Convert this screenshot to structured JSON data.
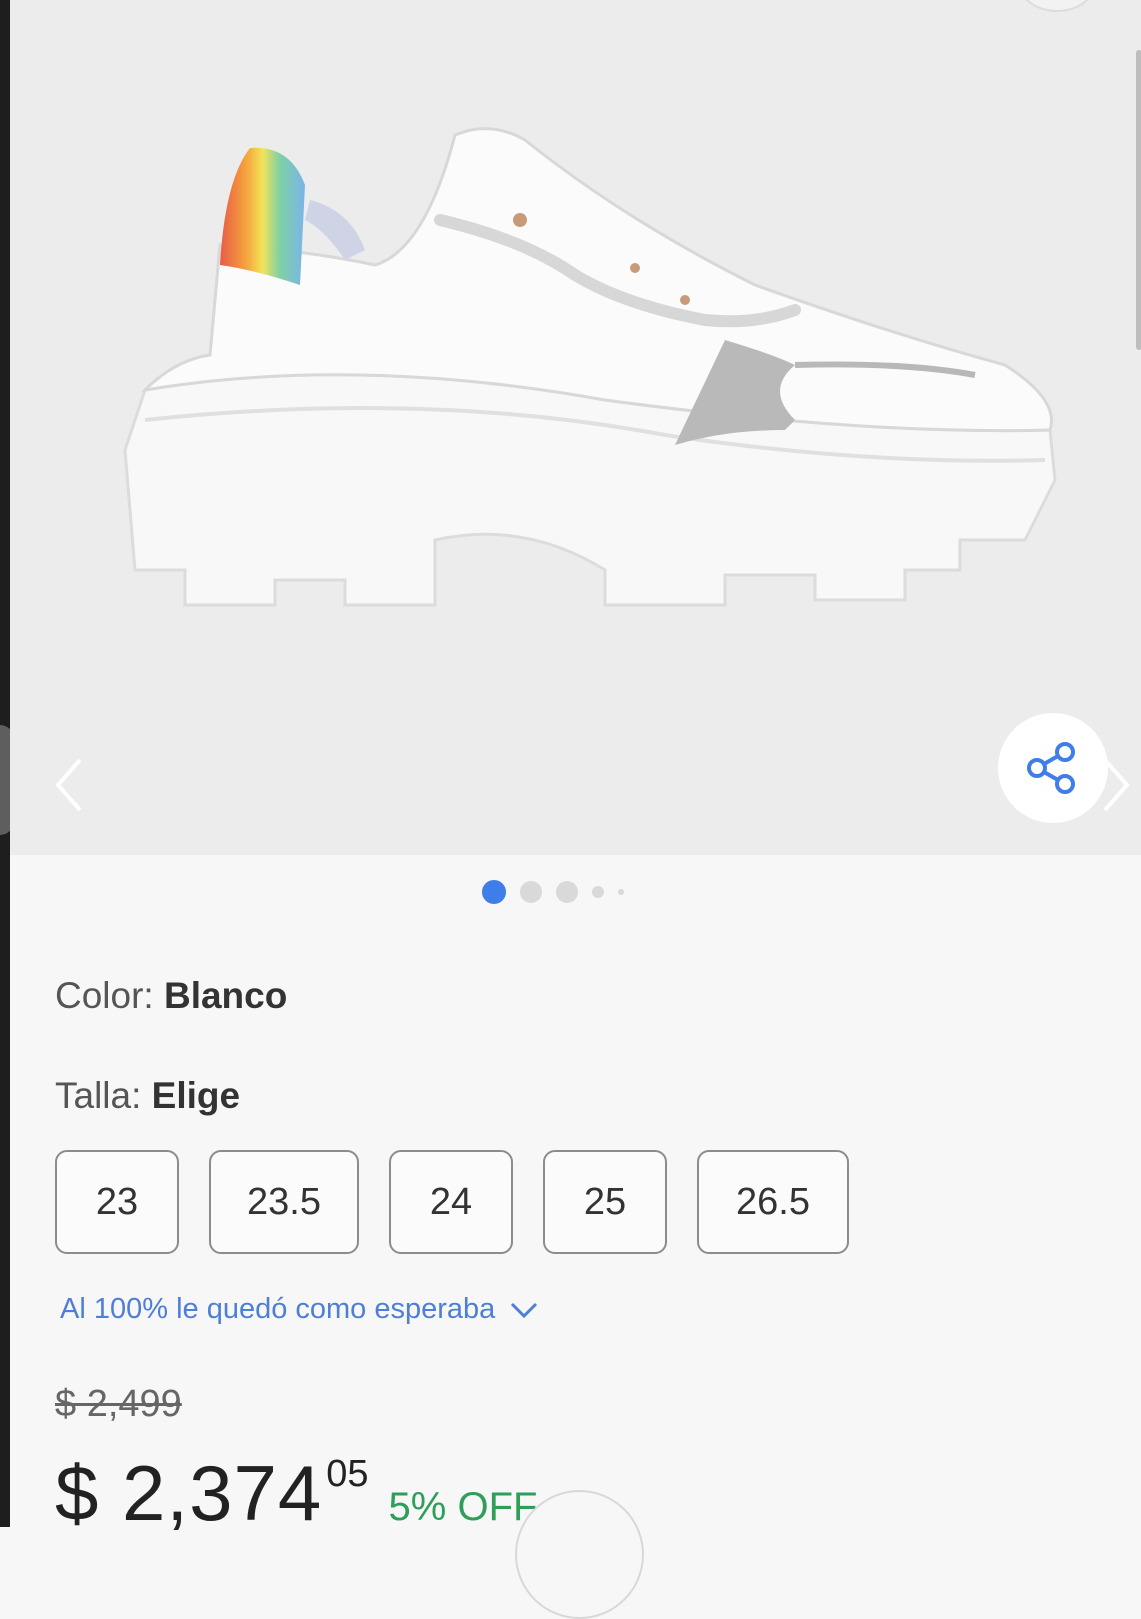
{
  "gallery": {
    "image_alt": "Tenis blancos con plataforma",
    "current_slide": 1,
    "total_slides": 5,
    "prev_icon": "chevron-left-icon",
    "next_icon": "chevron-right-icon",
    "share_icon": "share-icon"
  },
  "product": {
    "color_label": "Color:",
    "color_value": "Blanco",
    "size_label": "Talla:",
    "size_value": "Elige",
    "sizes": [
      "23",
      "23.5",
      "24",
      "25",
      "26.5"
    ],
    "fit_text": "Al 100% le quedó como esperaba",
    "old_price": "$ 2,499",
    "price_main": "$ 2,374",
    "price_cents": "05",
    "discount": "5% OFF"
  },
  "colors": {
    "accent": "#3f7de8",
    "discount": "#2f9e5b",
    "link": "#4d7fd8"
  }
}
